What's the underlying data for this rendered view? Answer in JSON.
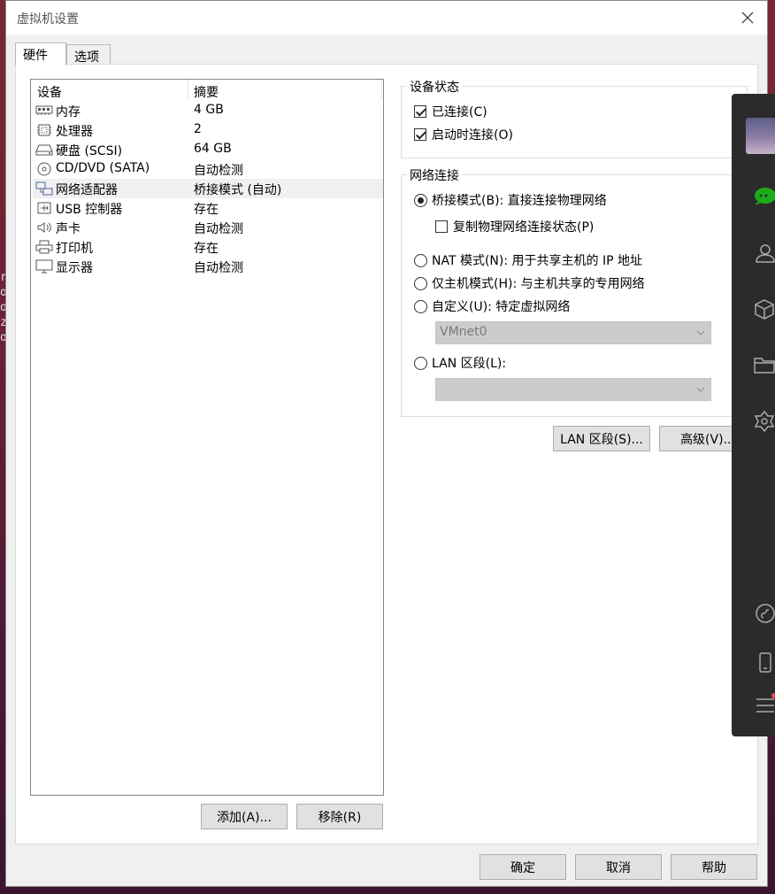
{
  "window": {
    "title": "虚拟机设置"
  },
  "tabs": [
    {
      "label": "硬件",
      "active": true
    },
    {
      "label": "选项",
      "active": false
    }
  ],
  "device_list": {
    "columns": [
      "设备",
      "摘要"
    ],
    "rows": [
      {
        "icon": "memory-icon",
        "name": "内存",
        "summary": "4 GB"
      },
      {
        "icon": "processor-icon",
        "name": "处理器",
        "summary": "2"
      },
      {
        "icon": "harddisk-icon",
        "name": "硬盘 (SCSI)",
        "summary": "64 GB"
      },
      {
        "icon": "cdrom-icon",
        "name": "CD/DVD (SATA)",
        "summary": "自动检测"
      },
      {
        "icon": "network-adapter-icon",
        "name": "网络适配器",
        "summary": "桥接模式 (自动)",
        "selected": true
      },
      {
        "icon": "usb-icon",
        "name": "USB 控制器",
        "summary": "存在"
      },
      {
        "icon": "speaker-icon",
        "name": "声卡",
        "summary": "自动检测"
      },
      {
        "icon": "printer-icon",
        "name": "打印机",
        "summary": "存在"
      },
      {
        "icon": "display-icon",
        "name": "显示器",
        "summary": "自动检测"
      }
    ],
    "add_label": "添加(A)...",
    "remove_label": "移除(R)"
  },
  "device_status": {
    "legend": "设备状态",
    "connected_label": "已连接(C)",
    "connected": true,
    "connect_at_power_on_label": "启动时连接(O)",
    "connect_at_power_on": true
  },
  "network": {
    "legend": "网络连接",
    "bridged_label": "桥接模式(B): 直接连接物理网络",
    "replicate_label": "复制物理网络连接状态(P)",
    "replicate": false,
    "nat_label": "NAT 模式(N): 用于共享主机的 IP 地址",
    "hostonly_label": "仅主机模式(H): 与主机共享的专用网络",
    "custom_label": "自定义(U): 特定虚拟网络",
    "custom_select_value": "VMnet0",
    "lan_segment_label": "LAN 区段(L):",
    "lan_segment_value": "",
    "selected_mode": "bridged",
    "lan_segments_button": "LAN 区段(S)...",
    "advanced_button": "高级(V)..."
  },
  "footer": {
    "ok": "确定",
    "cancel": "取消",
    "help": "帮助"
  },
  "background": {
    "terminal_chars": [
      "ri",
      "o",
      "os",
      "z",
      "os"
    ]
  },
  "side_panel": {
    "icons": [
      "chat-icon",
      "contacts-icon",
      "box-icon",
      "folder-icon",
      "hexagon-icon",
      "music-icon",
      "phone-icon",
      "menu-icon"
    ]
  }
}
